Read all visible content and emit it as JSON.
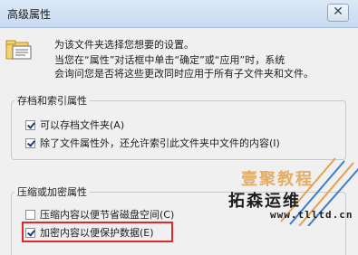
{
  "window": {
    "title": "高级属性",
    "close_glyph": "✕"
  },
  "intro": {
    "line1": "为该文件夹选择您想要的设置。",
    "line2": "当您在“属性”对话框中单击“确定”或“应用”时，系统",
    "line3": "会询问您是否将这些更改同时应用于所有子文件夹和文件。"
  },
  "archive_group": {
    "title": "存档和索引属性",
    "items": [
      {
        "label": "可以存档文件夹(A)",
        "checked": true
      },
      {
        "label": "除了文件属性外，还允许索引此文件夹中文件的内容(I)",
        "checked": true
      }
    ]
  },
  "compress_group": {
    "title": "压缩或加密属性",
    "items": [
      {
        "label": "压缩内容以便节省磁盘空间(C)",
        "checked": false
      },
      {
        "label": "加密内容以便保护数据(E)",
        "checked": true
      }
    ]
  },
  "watermark": {
    "line1": "壹聚教程",
    "line2": "拓森运维",
    "url": "www.tlltd.cn"
  },
  "colors": {
    "highlight": "#e4262a",
    "watermark_accent": "#e3a24d"
  }
}
